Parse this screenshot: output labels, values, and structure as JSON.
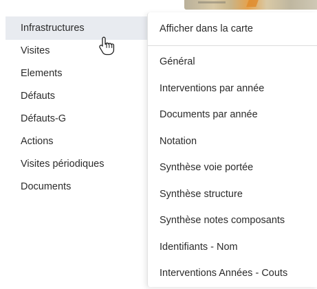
{
  "left_menu": {
    "items": [
      {
        "label": "Infrastructures"
      },
      {
        "label": "Visites"
      },
      {
        "label": "Elements"
      },
      {
        "label": "Défauts"
      },
      {
        "label": "Défauts-G"
      },
      {
        "label": "Actions"
      },
      {
        "label": "Visites périodiques"
      },
      {
        "label": "Documents"
      }
    ],
    "active_index": 0
  },
  "submenu": {
    "header": "Afficher dans la carte",
    "items": [
      {
        "label": "Général"
      },
      {
        "label": "Interventions par année"
      },
      {
        "label": "Documents par année"
      },
      {
        "label": "Notation"
      },
      {
        "label": "Synthèse voie portée"
      },
      {
        "label": "Synthèse structure"
      },
      {
        "label": "Synthèse notes composants"
      },
      {
        "label": "Identifiants - Nom"
      },
      {
        "label": "Interventions Années - Couts"
      }
    ]
  },
  "cursor": {
    "icon": "hand-pointer-icon"
  },
  "colors": {
    "active_item_bg": "#e8ebf0",
    "text": "#2b2b2b",
    "divider": "#dcdcdc"
  }
}
